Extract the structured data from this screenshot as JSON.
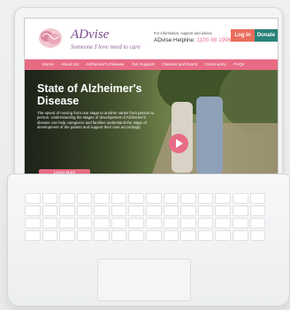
{
  "site": {
    "brand": "ADvise",
    "tagline": "Someone I love need to care",
    "helpline_note": "For information, support and advice",
    "helpline_label": "ADvise Helpline: ",
    "helpline_number": "1100 88 1996",
    "login": "Log In",
    "donate": "Donate"
  },
  "nav": [
    "Home",
    "About Us",
    "Alzheimer's Disease",
    "Get Support",
    "Classes and Event",
    "Community",
    "FAQs"
  ],
  "hero": {
    "title": "State of Alzheimer's Disease",
    "body": "The speed of moving from one stage to another varies from person to person. Understanding the stages of development of Alzheimer's disease can help caregivers and families understand the stage of development of the patient and support their care accordingly.",
    "cta": "Learn More"
  },
  "colors": {
    "pink": "#e86b84",
    "coral": "#ea6d5c",
    "teal": "#29827a",
    "purple": "#7a4d8e"
  }
}
